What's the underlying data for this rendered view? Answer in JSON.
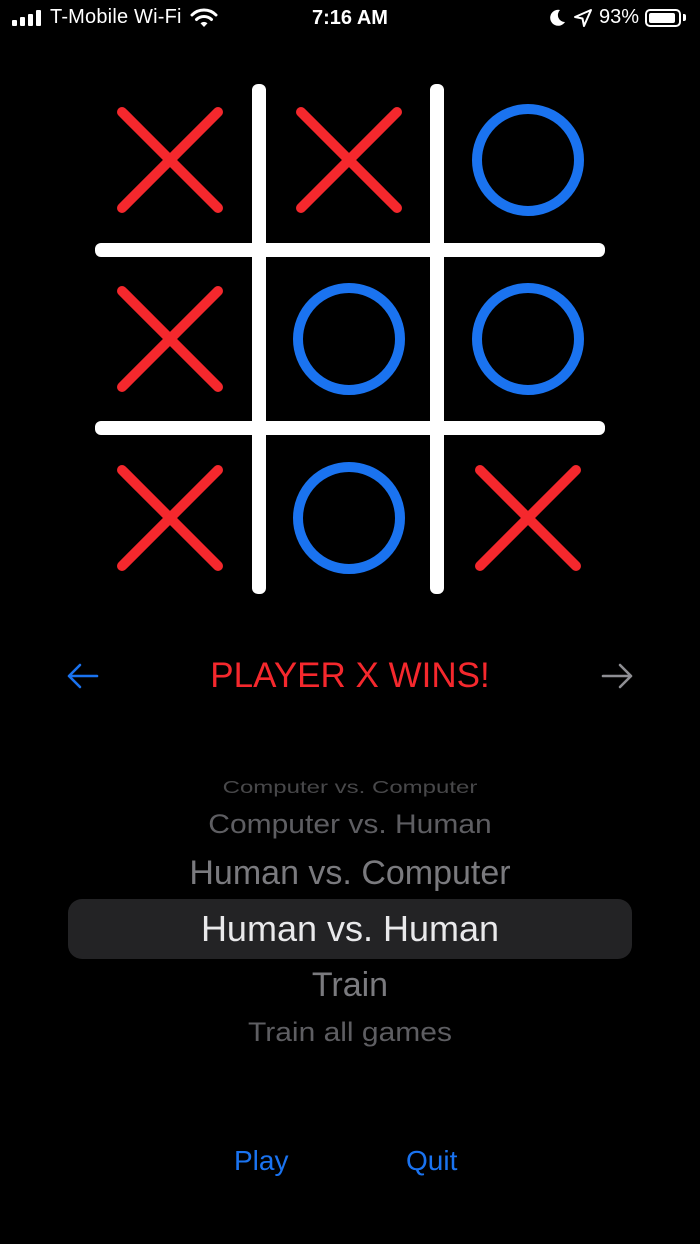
{
  "status_bar": {
    "carrier": "T-Mobile Wi-Fi",
    "time": "7:16 AM",
    "battery_percent": "93%",
    "battery_level": 0.93,
    "icons": [
      "signal-bars-icon",
      "wifi-icon",
      "moon-icon",
      "location-arrow-icon",
      "battery-icon"
    ]
  },
  "board": {
    "cells": [
      "X",
      "X",
      "O",
      "X",
      "O",
      "O",
      "X",
      "O",
      "X"
    ],
    "colors": {
      "x": "#f5282d",
      "o": "#1a73f0",
      "grid": "#ffffff"
    }
  },
  "result": {
    "text": "PLAYER X WINS!",
    "color": "#f5282d",
    "prev_icon": "arrow-left-icon",
    "next_icon": "arrow-right-icon",
    "prev_color": "#1a73f0",
    "next_color": "#8e8e93"
  },
  "mode_picker": {
    "options": [
      "Computer vs. Computer",
      "Computer vs. Human",
      "Human vs. Computer",
      "Human vs. Human",
      "Train",
      "Train all games"
    ],
    "selected": "Human vs. Human"
  },
  "actions": {
    "play_label": "Play",
    "quit_label": "Quit",
    "accent_color": "#1a73f0"
  },
  "background_color": "#000000"
}
